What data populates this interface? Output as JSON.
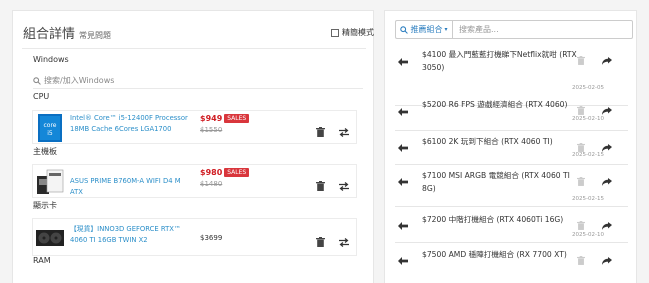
{
  "left": {
    "title": "組合詳情",
    "subtitle": "常見問題",
    "expert_mode": "精簡模式",
    "os_label": "Windows",
    "search_placeholder": "搜索/加入Windows",
    "sections": [
      {
        "label": "CPU",
        "product": {
          "name": "Intel® Core™ i5-12400F Processor 18MB Cache 6Cores LGA1700",
          "price": "$949",
          "badge": "SALES",
          "old_price": "$1550"
        }
      },
      {
        "label": "主機板",
        "product": {
          "name": "ASUS PRIME B760M-A WIFI D4 M ATX",
          "price": "$980",
          "badge": "SALES",
          "old_price": "$1480"
        }
      },
      {
        "label": "顯示卡",
        "product": {
          "name": "【現貨】INNO3D GEFORCE RTX™ 4060 TI 16GB TWIN X2",
          "price": "$3699",
          "badge": "",
          "old_price": ""
        }
      },
      {
        "label": "RAM"
      }
    ]
  },
  "right": {
    "dropdown_label": "推薦組合",
    "search_placeholder": "搜索產品...",
    "items": [
      {
        "title": "$4100 最入門藍藍打機睇下Netflix就咁 (RTX 3050)",
        "date": "2025-02-05"
      },
      {
        "title": "$5200 R6 FPS 遊戲經濟組合 (RTX 4060)",
        "date": "2025-02-10"
      },
      {
        "title": "$6100 2K 玩到下組合 (RTX 4060 TI)",
        "date": "2025-02-15"
      },
      {
        "title": "$7100 MSI ARGB 電競組合 (RTX 4060 TI 8G)",
        "date": "2025-02-15"
      },
      {
        "title": "$7200 中階打機組合 (RTX 4060Ti 16G)",
        "date": "2025-02-10"
      },
      {
        "title": "$7500 AMD 穩陣打機組合 (RX 7700 XT)",
        "date": ""
      }
    ]
  },
  "colors": {
    "link": "#2c8fc9",
    "sale": "#d01c22",
    "badge": "#d9363c",
    "accent": "#2a7dbf"
  }
}
